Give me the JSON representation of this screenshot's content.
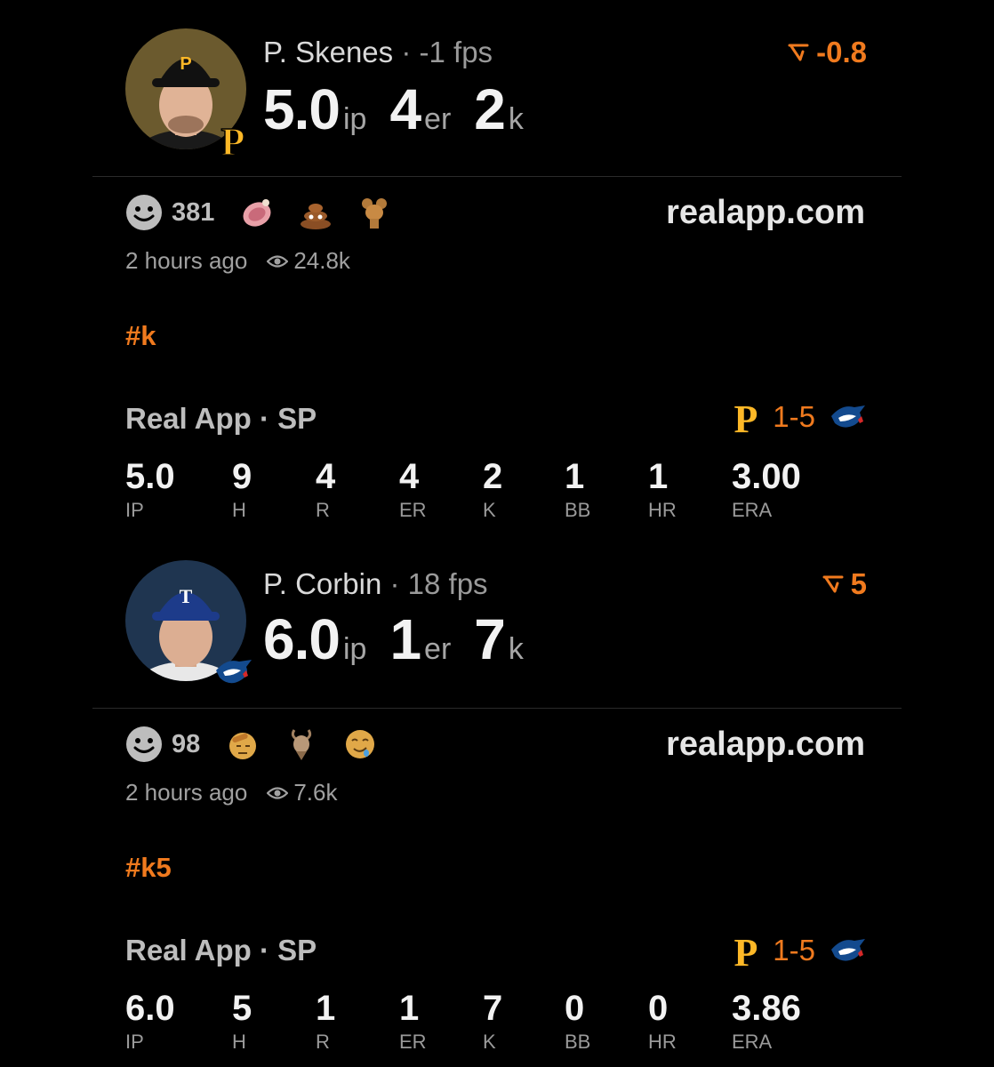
{
  "posts": [
    {
      "player": "P. Skenes",
      "fps": "-1 fps",
      "delta": "-0.8",
      "stats": [
        {
          "value": "5.0",
          "unit": "ip"
        },
        {
          "value": "4",
          "unit": "er"
        },
        {
          "value": "2",
          "unit": "k"
        }
      ],
      "reaction_count": "381",
      "site": "realapp.com",
      "time": "2 hours ago",
      "views": "24.8k",
      "hashtag": "#k",
      "source": "Real App · SP",
      "score": "1-5",
      "box": [
        {
          "label": "IP",
          "value": "5.0"
        },
        {
          "label": "H",
          "value": "9"
        },
        {
          "label": "R",
          "value": "4"
        },
        {
          "label": "ER",
          "value": "4"
        },
        {
          "label": "K",
          "value": "2"
        },
        {
          "label": "BB",
          "value": "1"
        },
        {
          "label": "HR",
          "value": "1"
        },
        {
          "label": "ERA",
          "value": "3.00"
        }
      ]
    },
    {
      "player": "P. Corbin",
      "fps": "18 fps",
      "delta": "5",
      "stats": [
        {
          "value": "6.0",
          "unit": "ip"
        },
        {
          "value": "1",
          "unit": "er"
        },
        {
          "value": "7",
          "unit": "k"
        }
      ],
      "reaction_count": "98",
      "site": "realapp.com",
      "time": "2 hours ago",
      "views": "7.6k",
      "hashtag": "#k5",
      "source": "Real App · SP",
      "score": "1-5",
      "box": [
        {
          "label": "IP",
          "value": "6.0"
        },
        {
          "label": "H",
          "value": "5"
        },
        {
          "label": "R",
          "value": "1"
        },
        {
          "label": "ER",
          "value": "1"
        },
        {
          "label": "K",
          "value": "7"
        },
        {
          "label": "BB",
          "value": "0"
        },
        {
          "label": "HR",
          "value": "0"
        },
        {
          "label": "ERA",
          "value": "3.86"
        }
      ]
    }
  ],
  "separator": "·",
  "colors": {
    "accent": "#f07a1e",
    "pirates_gold": "#fdb827",
    "bluejays_blue": "#134a8e"
  },
  "icons": [
    "smiley-icon",
    "eye-icon",
    "trend-arrow-icon",
    "pirates-logo-icon",
    "bluejays-logo-icon"
  ]
}
